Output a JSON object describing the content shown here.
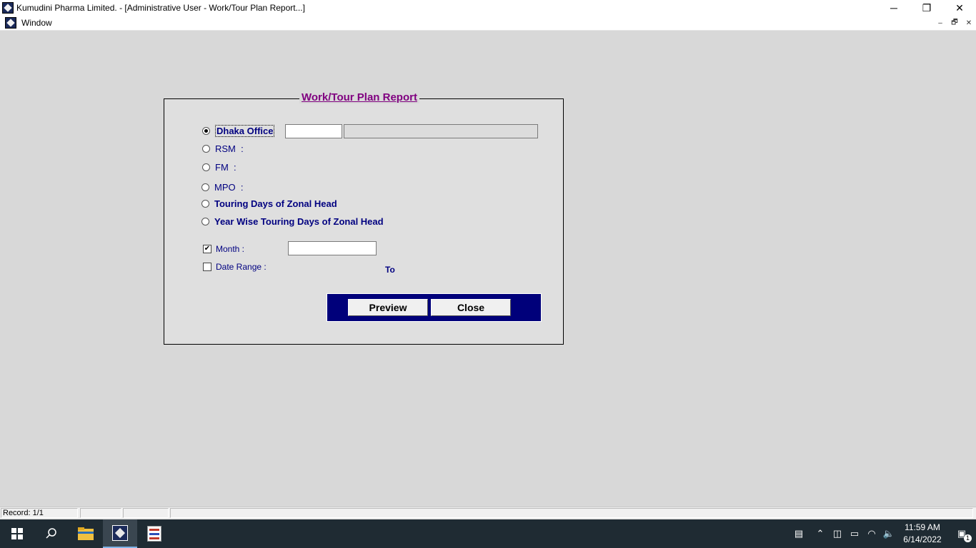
{
  "window": {
    "title": "Kumudini Pharma Limited. - [Administrative User - Work/Tour Plan Report...]",
    "minimize": "─",
    "restore": "❐",
    "close": "✕"
  },
  "menu": {
    "items": [
      "Window"
    ],
    "mdi_minimize": "–",
    "mdi_restore": "🗗",
    "mdi_close": "✕"
  },
  "form": {
    "title": "Work/Tour Plan Report",
    "options": {
      "dhaka_office": "Dhaka Office",
      "rsm": "RSM  :",
      "fm": "FM  :",
      "mpo": "MPO  :",
      "touring_days": "Touring Days of Zonal Head",
      "year_wise": "Year Wise Touring Days of Zonal Head"
    },
    "selected_option": "dhaka_office",
    "dhaka_code_value": "",
    "dhaka_name_value": "",
    "month_label": "Month :",
    "month_checked": true,
    "month_value": "",
    "date_range_label": "Date Range :",
    "date_range_checked": false,
    "to_label": "To",
    "preview_button": "Preview",
    "close_button": "Close"
  },
  "statusbar": {
    "record": "Record: 1/1"
  },
  "taskbar": {
    "time": "11:59 AM",
    "date": "6/14/2022",
    "notification_count": "1"
  }
}
